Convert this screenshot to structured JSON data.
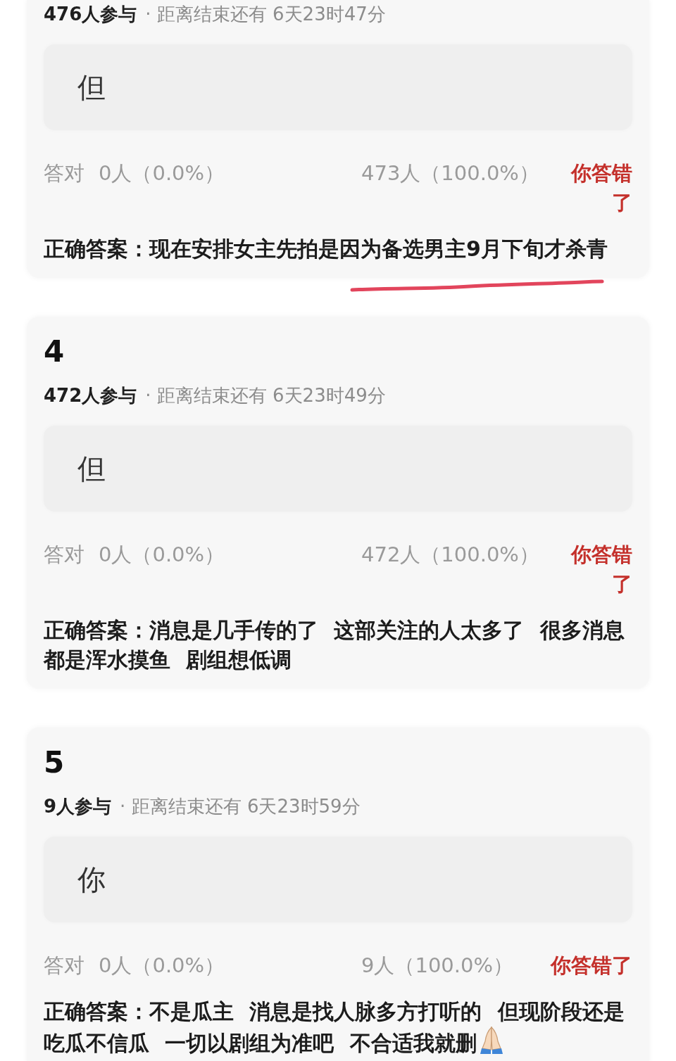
{
  "cards": [
    {
      "participants": "476人参与",
      "deadline": "· 距离结束还有 6天23时47分",
      "option": "但",
      "correct_label": "答对",
      "correct_count": "0人（0.0%）",
      "other_count": "473人（100.0%）",
      "verdict": "你答错了",
      "answer": "正确答案：现在安排女主先拍是因为备选男主9月下旬才杀青",
      "underlined": true,
      "end_icon": false
    },
    {
      "number": "4",
      "participants": "472人参与",
      "deadline": "· 距离结束还有 6天23时49分",
      "option": "但",
      "correct_label": "答对",
      "correct_count": "0人（0.0%）",
      "other_count": "472人（100.0%）",
      "verdict": "你答错了",
      "answer": "正确答案：消息是几手传的了 这部关注的人太多了 很多消息都是浑水摸鱼 剧组想低调",
      "underlined": false,
      "end_icon": false
    },
    {
      "number": "5",
      "participants": "9人参与",
      "deadline": "· 距离结束还有 6天23时59分",
      "option": "你",
      "correct_label": "答对",
      "correct_count": "0人（0.0%）",
      "other_count": "9人（100.0%）",
      "verdict": "你答错了",
      "answer": "正确答案：不是瓜主 消息是找人脉多方打听的 但现阶段还是吃瓜不信瓜 一切以剧组为准吧 不合适我就删",
      "underlined": false,
      "end_icon": true
    }
  ]
}
